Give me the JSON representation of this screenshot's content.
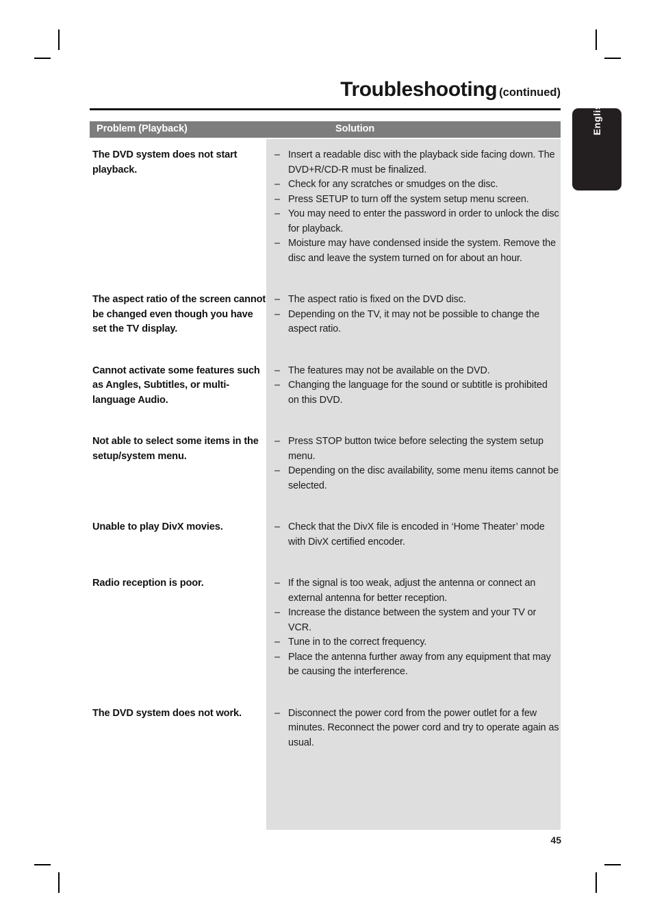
{
  "header": {
    "title": "Troubleshooting",
    "title_suffix": "(continued)"
  },
  "side_tab": {
    "label": "English"
  },
  "table": {
    "columns": {
      "problem": "Problem (Playback)",
      "solution": "Solution"
    },
    "rows": [
      {
        "problem": "The DVD system does not start playback.",
        "solutions": [
          "Insert a readable disc with the playback side facing down. The DVD+R/CD-R must be finalized.",
          "Check for any scratches or smudges on the disc.",
          "Press SETUP to turn off the system setup menu screen.",
          "You may need to enter the password in order to unlock the disc for playback.",
          "Moisture may have condensed inside the system. Remove the disc and leave the system turned on for about an hour."
        ]
      },
      {
        "problem": "The aspect ratio of the screen cannot be changed even though you have set the TV display.",
        "solutions": [
          "The aspect ratio is fixed on the DVD disc.",
          "Depending on the TV, it may not be possible to change the aspect ratio."
        ]
      },
      {
        "problem": "Cannot activate some features such as Angles, Subtitles, or multi-language Audio.",
        "solutions": [
          "The features may not be available on the DVD.",
          "Changing the language for the sound or subtitle is prohibited on this DVD."
        ]
      },
      {
        "problem": "Not able to select some items in the setup/system menu.",
        "solutions": [
          "Press STOP button twice before selecting the system setup menu.",
          "Depending on the disc availability, some menu items cannot be selected."
        ]
      },
      {
        "problem": "Unable to play DivX movies.",
        "solutions": [
          "Check that the DivX file is encoded in ‘Home Theater’ mode with DivX certified encoder."
        ]
      },
      {
        "problem": "Radio reception is poor.",
        "solutions": [
          "If the signal is too weak, adjust the antenna or connect an external antenna for better reception.",
          "Increase the distance between the system and your TV or VCR.",
          "Tune in to the correct frequency.",
          "Place the antenna further away from any equipment that may be causing the interference."
        ]
      },
      {
        "problem": "The DVD system does not work.",
        "solutions": [
          "Disconnect the power cord from the power outlet for a few minutes. Reconnect the power cord and try to operate again as usual."
        ]
      }
    ]
  },
  "footer": {
    "page_number": "45"
  },
  "bullet_dash": "–",
  "colors": {
    "table_header_bg": "#7d7d7d",
    "solution_bg": "#dedede",
    "tab_bg": "#231f20"
  }
}
